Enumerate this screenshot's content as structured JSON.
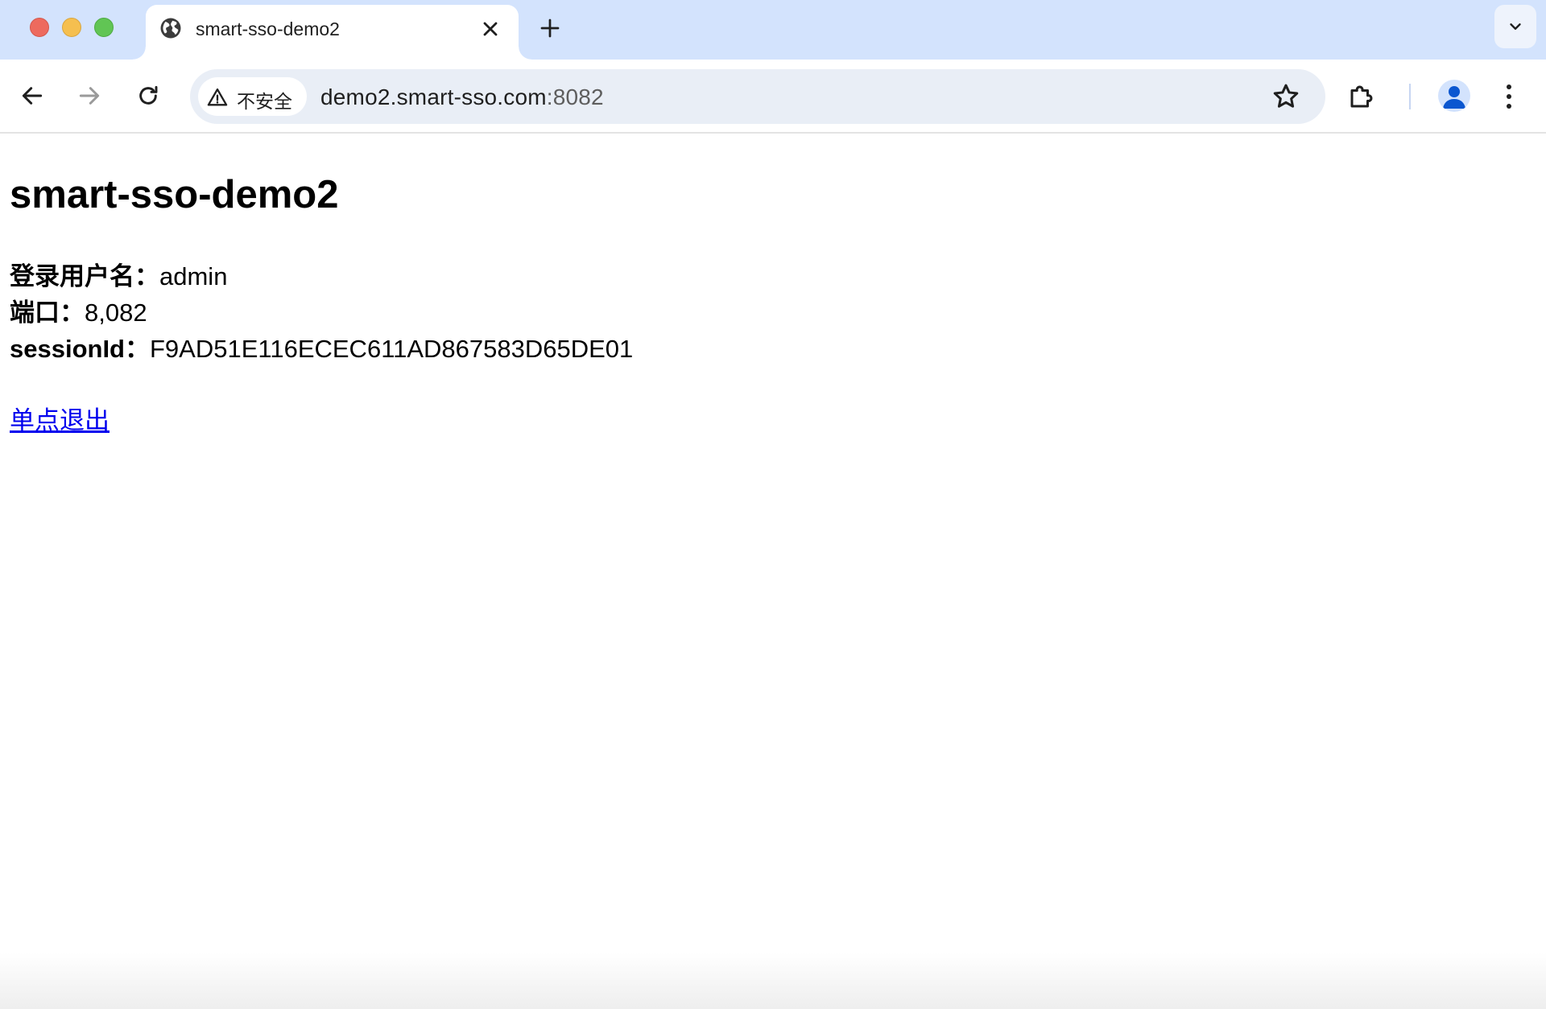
{
  "browser": {
    "tab": {
      "title": "smart-sso-demo2"
    },
    "address_bar": {
      "security_label": "不安全",
      "url_host": "demo2.smart-sso.com",
      "url_port": ":8082"
    }
  },
  "page": {
    "heading": "smart-sso-demo2",
    "fields": [
      {
        "label": "登录用户名",
        "separator": "：",
        "value": "admin"
      },
      {
        "label": "端口",
        "separator": "：",
        "value": "8,082"
      },
      {
        "label": "sessionId",
        "separator": "：",
        "value": "F9AD51E116ECEC611AD867583D65DE01"
      }
    ],
    "logout_link": "单点退出"
  },
  "colors": {
    "tabstrip_bg": "#d3e3fd",
    "omnibox_bg": "#e9eef6",
    "link": "#0000ee"
  }
}
